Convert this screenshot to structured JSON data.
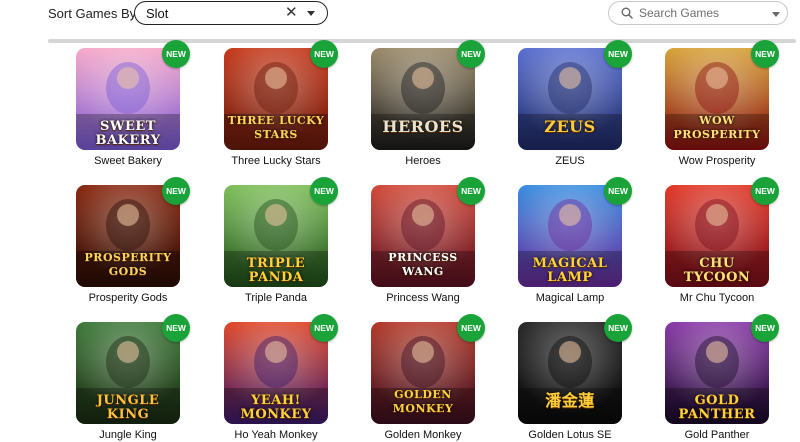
{
  "sort": {
    "label": "Sort Games By:",
    "value": "Slot",
    "clear_icon": "close-icon",
    "caret_icon": "chevron-down-icon"
  },
  "search": {
    "placeholder": "Search Games",
    "icon": "search-icon",
    "caret_icon": "chevron-down-icon"
  },
  "badge_label": "NEW",
  "colors": {
    "badge": "#1aa338",
    "select_border": "#222222",
    "divider": "#d6d6d6"
  },
  "games": [
    {
      "name": "Sweet Bakery",
      "art_text": "Sweet Bakery",
      "bg1": "#f6a9c8",
      "bg2": "#7b5bd6",
      "fg": "#ffffff"
    },
    {
      "name": "Three Lucky Stars",
      "art_text": "Three Lucky Stars",
      "bg1": "#c63b1e",
      "bg2": "#6b1a0b",
      "fg": "#ffd45a"
    },
    {
      "name": "Heroes",
      "art_text": "Heroes",
      "bg1": "#9a8a6a",
      "bg2": "#1b1b1b",
      "fg": "#e8e2cf"
    },
    {
      "name": "ZEUS",
      "art_text": "ZEUS",
      "bg1": "#5a6fd0",
      "bg2": "#1e2a66",
      "fg": "#ffcb3b"
    },
    {
      "name": "Wow Prosperity",
      "art_text": "Wow Prosperity",
      "bg1": "#d6a33a",
      "bg2": "#8a1010",
      "fg": "#ffe07a"
    },
    {
      "name": "Prosperity Gods",
      "art_text": "Prosperity Gods",
      "bg1": "#8a2a12",
      "bg2": "#2b0d05",
      "fg": "#ffd45a"
    },
    {
      "name": "Triple Panda",
      "art_text": "Triple Panda",
      "bg1": "#7fbf5a",
      "bg2": "#1f4f1a",
      "fg": "#ffd23a"
    },
    {
      "name": "Princess Wang",
      "art_text": "Princess Wang",
      "bg1": "#d24a3a",
      "bg2": "#5a1022",
      "fg": "#ffffff"
    },
    {
      "name": "Magical Lamp",
      "art_text": "Magical Lamp",
      "bg1": "#3a8ee0",
      "bg2": "#6a2a9a",
      "fg": "#ffd23a"
    },
    {
      "name": "Mr Chu Tycoon",
      "art_text": "Chu Tycoon",
      "bg1": "#e23a2a",
      "bg2": "#7a0e1a",
      "fg": "#ffe07a"
    },
    {
      "name": "Jungle King",
      "art_text": "Jungle King",
      "bg1": "#3f7a3a",
      "bg2": "#1a2a12",
      "fg": "#ffc23a"
    },
    {
      "name": "Ho Yeah Monkey",
      "art_text": "Yeah! Monkey",
      "bg1": "#e0482a",
      "bg2": "#3a1a6a",
      "fg": "#ffd23a"
    },
    {
      "name": "Golden Monkey",
      "art_text": "Golden Monkey",
      "bg1": "#b43a2a",
      "bg2": "#3a0f20",
      "fg": "#ffd23a"
    },
    {
      "name": "Golden Lotus SE",
      "art_text": "潘金蓮",
      "bg1": "#2a2a2a",
      "bg2": "#0a0a0a",
      "fg": "#ffcf3a"
    },
    {
      "name": "Gold Panther",
      "art_text": "Gold Panther",
      "bg1": "#8a3aa8",
      "bg2": "#1a0a2a",
      "fg": "#ffd23a"
    }
  ]
}
